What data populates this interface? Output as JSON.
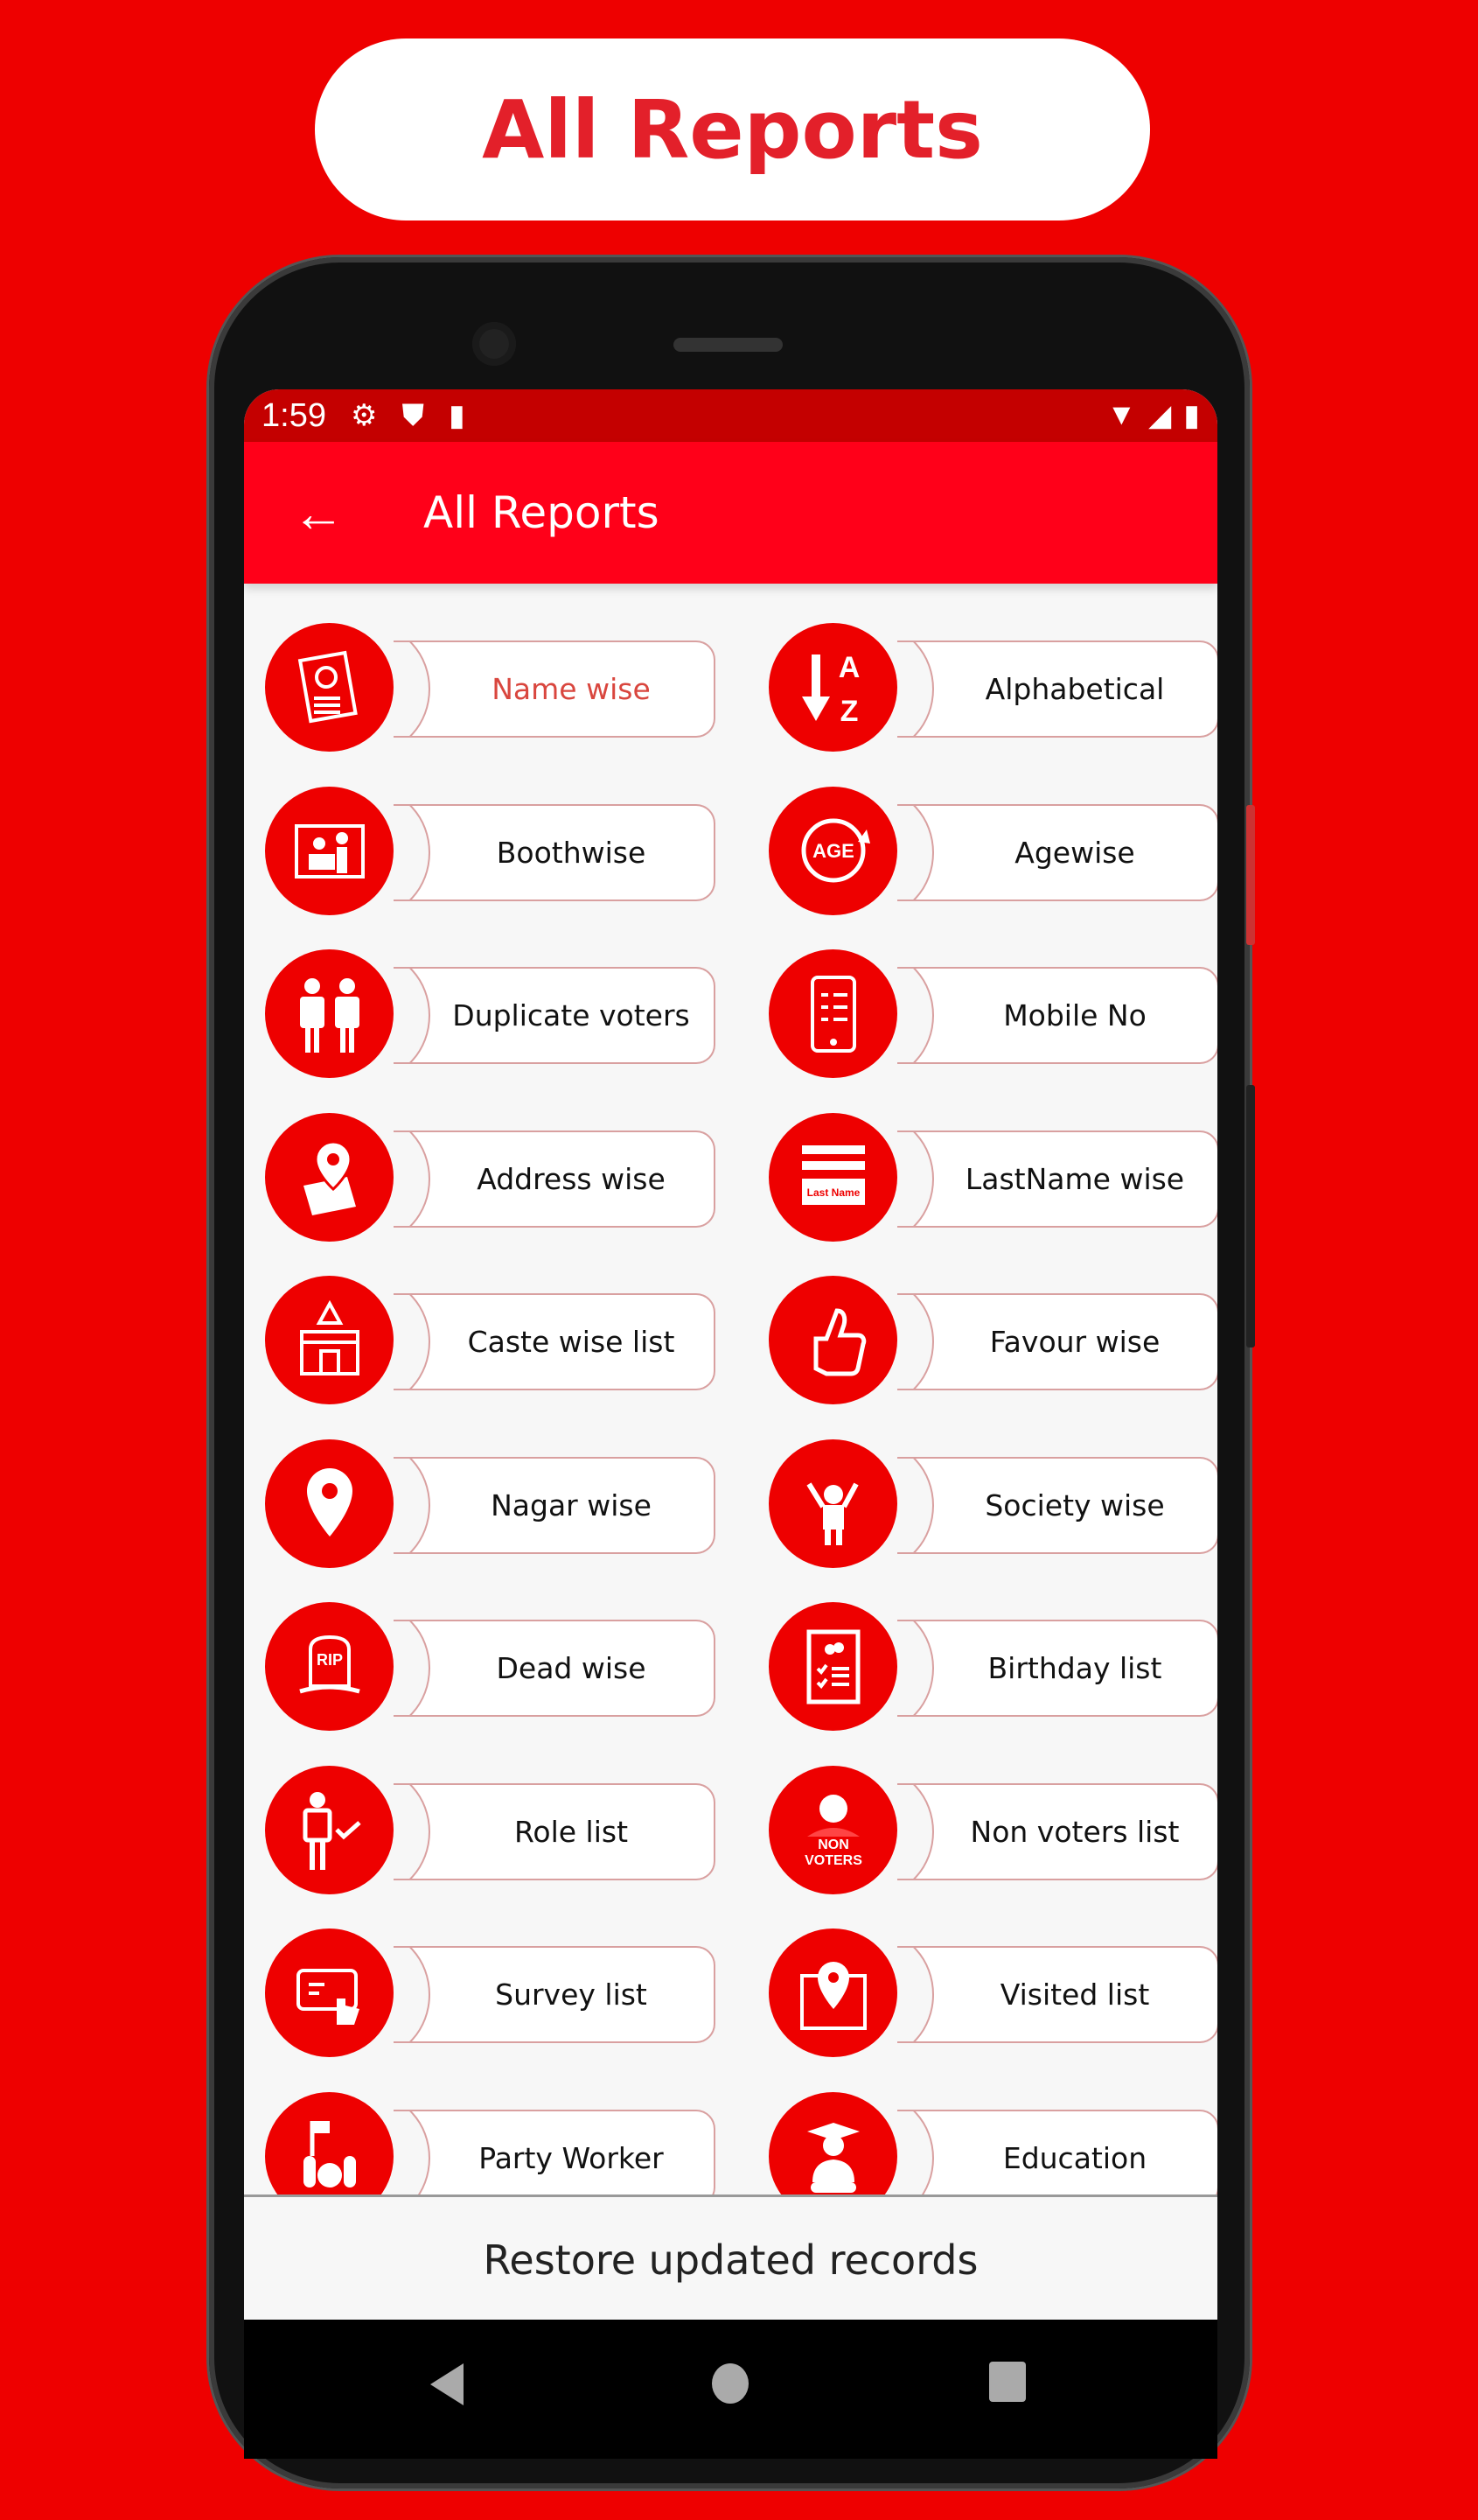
{
  "banner": {
    "title": "All Reports"
  },
  "status_bar": {
    "time": "1:59",
    "icons": [
      "gear-icon",
      "shield-play-icon",
      "sd-card-icon"
    ],
    "right_icons": [
      "wifi-icon",
      "signal-icon",
      "battery-icon"
    ]
  },
  "app_bar": {
    "back_icon": "arrow-left-icon",
    "title": "All Reports"
  },
  "colors": {
    "brand_red": "#ee0000",
    "appbar_red": "#ff0019",
    "status_red": "#c40000",
    "active_label": "#d9463e"
  },
  "reports": [
    {
      "label": "Name wise",
      "icon": "id-card-icon",
      "active": true
    },
    {
      "label": "Alphabetical",
      "icon": "sort-az-icon",
      "icon_text": [
        "A",
        "Z"
      ]
    },
    {
      "label": "Boothwise",
      "icon": "booth-icon"
    },
    {
      "label": "Agewise",
      "icon": "age-icon",
      "icon_text": [
        "AGE"
      ]
    },
    {
      "label": "Duplicate voters",
      "icon": "two-people-icon"
    },
    {
      "label": "Mobile No",
      "icon": "mobile-icon"
    },
    {
      "label": "Address wise",
      "icon": "map-pin-icon"
    },
    {
      "label": "LastName wise",
      "icon": "lastname-card-icon",
      "icon_text": [
        "Last Name"
      ]
    },
    {
      "label": "Caste wise list",
      "icon": "temple-icon"
    },
    {
      "label": "Favour wise",
      "icon": "thumbs-up-icon"
    },
    {
      "label": "Nagar wise",
      "icon": "location-pin-icon"
    },
    {
      "label": "Society wise",
      "icon": "person-flag-icon"
    },
    {
      "label": "Dead wise",
      "icon": "tombstone-icon",
      "icon_text": [
        "RIP"
      ]
    },
    {
      "label": "Birthday list",
      "icon": "birthday-checklist-icon"
    },
    {
      "label": "Role list",
      "icon": "person-check-icon"
    },
    {
      "label": "Non voters list",
      "icon": "non-voters-icon",
      "icon_text": [
        "NON",
        "VOTERS"
      ]
    },
    {
      "label": "Survey list",
      "icon": "survey-tap-icon"
    },
    {
      "label": "Visited list",
      "icon": "building-pin-icon"
    },
    {
      "label": "Party Worker",
      "icon": "party-worker-icon"
    },
    {
      "label": "Education",
      "icon": "graduate-icon"
    }
  ],
  "footer": {
    "restore_label": "Restore updated records"
  },
  "nav_bar": {
    "icons": [
      "back-triangle-icon",
      "home-circle-icon",
      "recents-square-icon"
    ]
  }
}
